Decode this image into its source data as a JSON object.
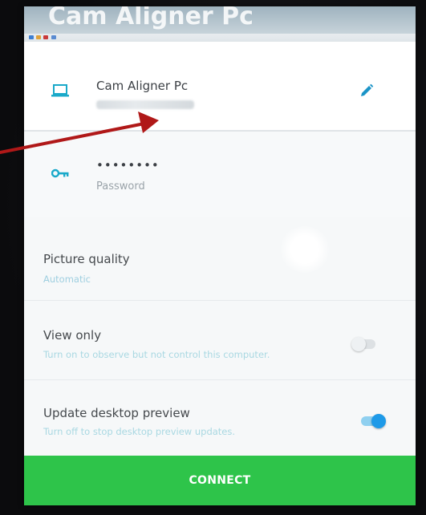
{
  "screen": {
    "header_text": "Cam Aligner Pc"
  },
  "computer": {
    "name": "Cam Aligner Pc",
    "icon": "laptop-icon",
    "edit_icon": "pencil-icon"
  },
  "password": {
    "value": "••••••••",
    "label": "Password",
    "icon": "key-icon"
  },
  "settings": {
    "picture_quality": {
      "title": "Picture quality",
      "value": "Automatic"
    },
    "view_only": {
      "title": "View only",
      "description": "Turn on to observe but not control this computer.",
      "enabled": false
    },
    "update_preview": {
      "title": "Update desktop preview",
      "description": "Turn off to stop desktop preview updates.",
      "enabled": true
    }
  },
  "connect": {
    "label": "CONNECT"
  },
  "colors": {
    "accent_icon": "#19a9c9",
    "connect_green": "#2ec44a",
    "toggle_on": "#1e9ae8",
    "annotation_arrow": "#b01818"
  }
}
